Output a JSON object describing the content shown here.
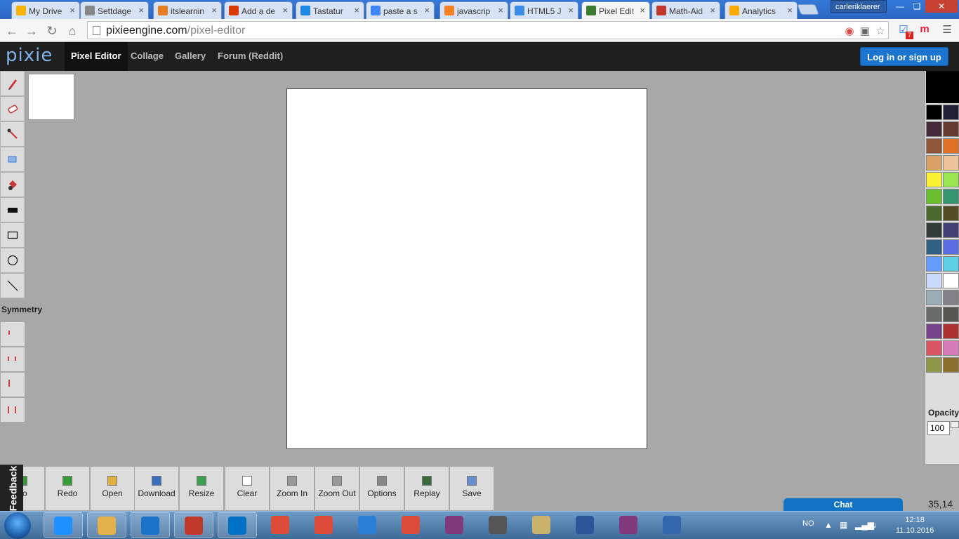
{
  "browser": {
    "tabs": [
      {
        "label": "My Drive",
        "color": "#f4b400"
      },
      {
        "label": "Settdage",
        "color": "#888888"
      },
      {
        "label": "itslearnin",
        "color": "#e67e22"
      },
      {
        "label": "Add a de",
        "color": "#d83b01"
      },
      {
        "label": "Tastatur",
        "color": "#1e88e5"
      },
      {
        "label": "paste a s",
        "color": "#4285f4"
      },
      {
        "label": "javascrip",
        "color": "#f48024"
      },
      {
        "label": "HTML5 J",
        "color": "#3a8ee6"
      },
      {
        "label": "Pixel Edit",
        "color": "#3a7d2c"
      },
      {
        "label": "Math-Aid",
        "color": "#c0392b"
      },
      {
        "label": "Analytics",
        "color": "#f9ab00"
      }
    ],
    "user": "carleriklaerer",
    "url_host": "pixieengine.com",
    "url_path": "/pixel-editor",
    "ext_badge": "7"
  },
  "header": {
    "logo": "pixie",
    "nav": [
      "Pixel Editor",
      "Collage",
      "Gallery",
      "Forum (Reddit)"
    ],
    "login": "Log in or sign up"
  },
  "tools": [
    {
      "name": "pencil-tool",
      "icon": "pencil-icon"
    },
    {
      "name": "eraser-tool",
      "icon": "eraser-icon"
    },
    {
      "name": "eyedropper-tool",
      "icon": "eyedropper-icon"
    },
    {
      "name": "selection-tool",
      "icon": "selection-icon"
    },
    {
      "name": "fill-tool",
      "icon": "bucket-icon"
    },
    {
      "name": "filled-rect-tool",
      "icon": "filled-rect-icon"
    },
    {
      "name": "rect-tool",
      "icon": "rect-icon"
    },
    {
      "name": "circle-tool",
      "icon": "circle-icon"
    },
    {
      "name": "line-tool",
      "icon": "line-icon"
    }
  ],
  "symmetry": {
    "label": "Symmetry"
  },
  "palette": {
    "current": "#000000",
    "colors": [
      "#000000",
      "#222034",
      "#45283c",
      "#663931",
      "#8f563b",
      "#df7126",
      "#d9a066",
      "#eec39a",
      "#fbf236",
      "#99e550",
      "#6abe30",
      "#37946e",
      "#4b692f",
      "#524b24",
      "#323c39",
      "#3f3f74",
      "#306082",
      "#5b6ee1",
      "#639bff",
      "#5fcde4",
      "#cbdbfc",
      "#ffffff",
      "#9badb7",
      "#847e87",
      "#696a6a",
      "#595652",
      "#76428a",
      "#ac3232",
      "#d95763",
      "#d77bba",
      "#8f974a",
      "#8a6f30"
    ],
    "opacity_label": "Opacity",
    "opacity_value": "100"
  },
  "actions": [
    {
      "label": "Undo",
      "visible": "do",
      "icon": "undo-icon"
    },
    {
      "label": "Redo",
      "icon": "redo-icon"
    },
    {
      "label": "Open",
      "icon": "folder-icon"
    },
    {
      "label": "Download",
      "icon": "download-icon"
    },
    {
      "label": "Resize",
      "icon": "resize-icon"
    },
    {
      "label": "Clear",
      "icon": "page-icon"
    },
    {
      "label": "Zoom In",
      "icon": "zoom-in-icon"
    },
    {
      "label": "Zoom Out",
      "icon": "zoom-out-icon"
    },
    {
      "label": "Options",
      "icon": "gear-icon"
    },
    {
      "label": "Replay",
      "icon": "film-icon"
    },
    {
      "label": "Save",
      "icon": "save-icon"
    }
  ],
  "feedback": "Feedback",
  "chat": "Chat",
  "coords": "35,14",
  "taskbar": {
    "lang": "NO",
    "time": "12:18",
    "date": "11.10.2016",
    "apps": [
      "Internet Explorer",
      "File Explorer",
      "OneDrive",
      "Tavla",
      "Outlook",
      "Chrome",
      "Chrome",
      "Tools",
      "Chrome",
      "OneNote",
      "GIMP",
      "Notes",
      "Word",
      "OneNote",
      "Paint"
    ]
  }
}
